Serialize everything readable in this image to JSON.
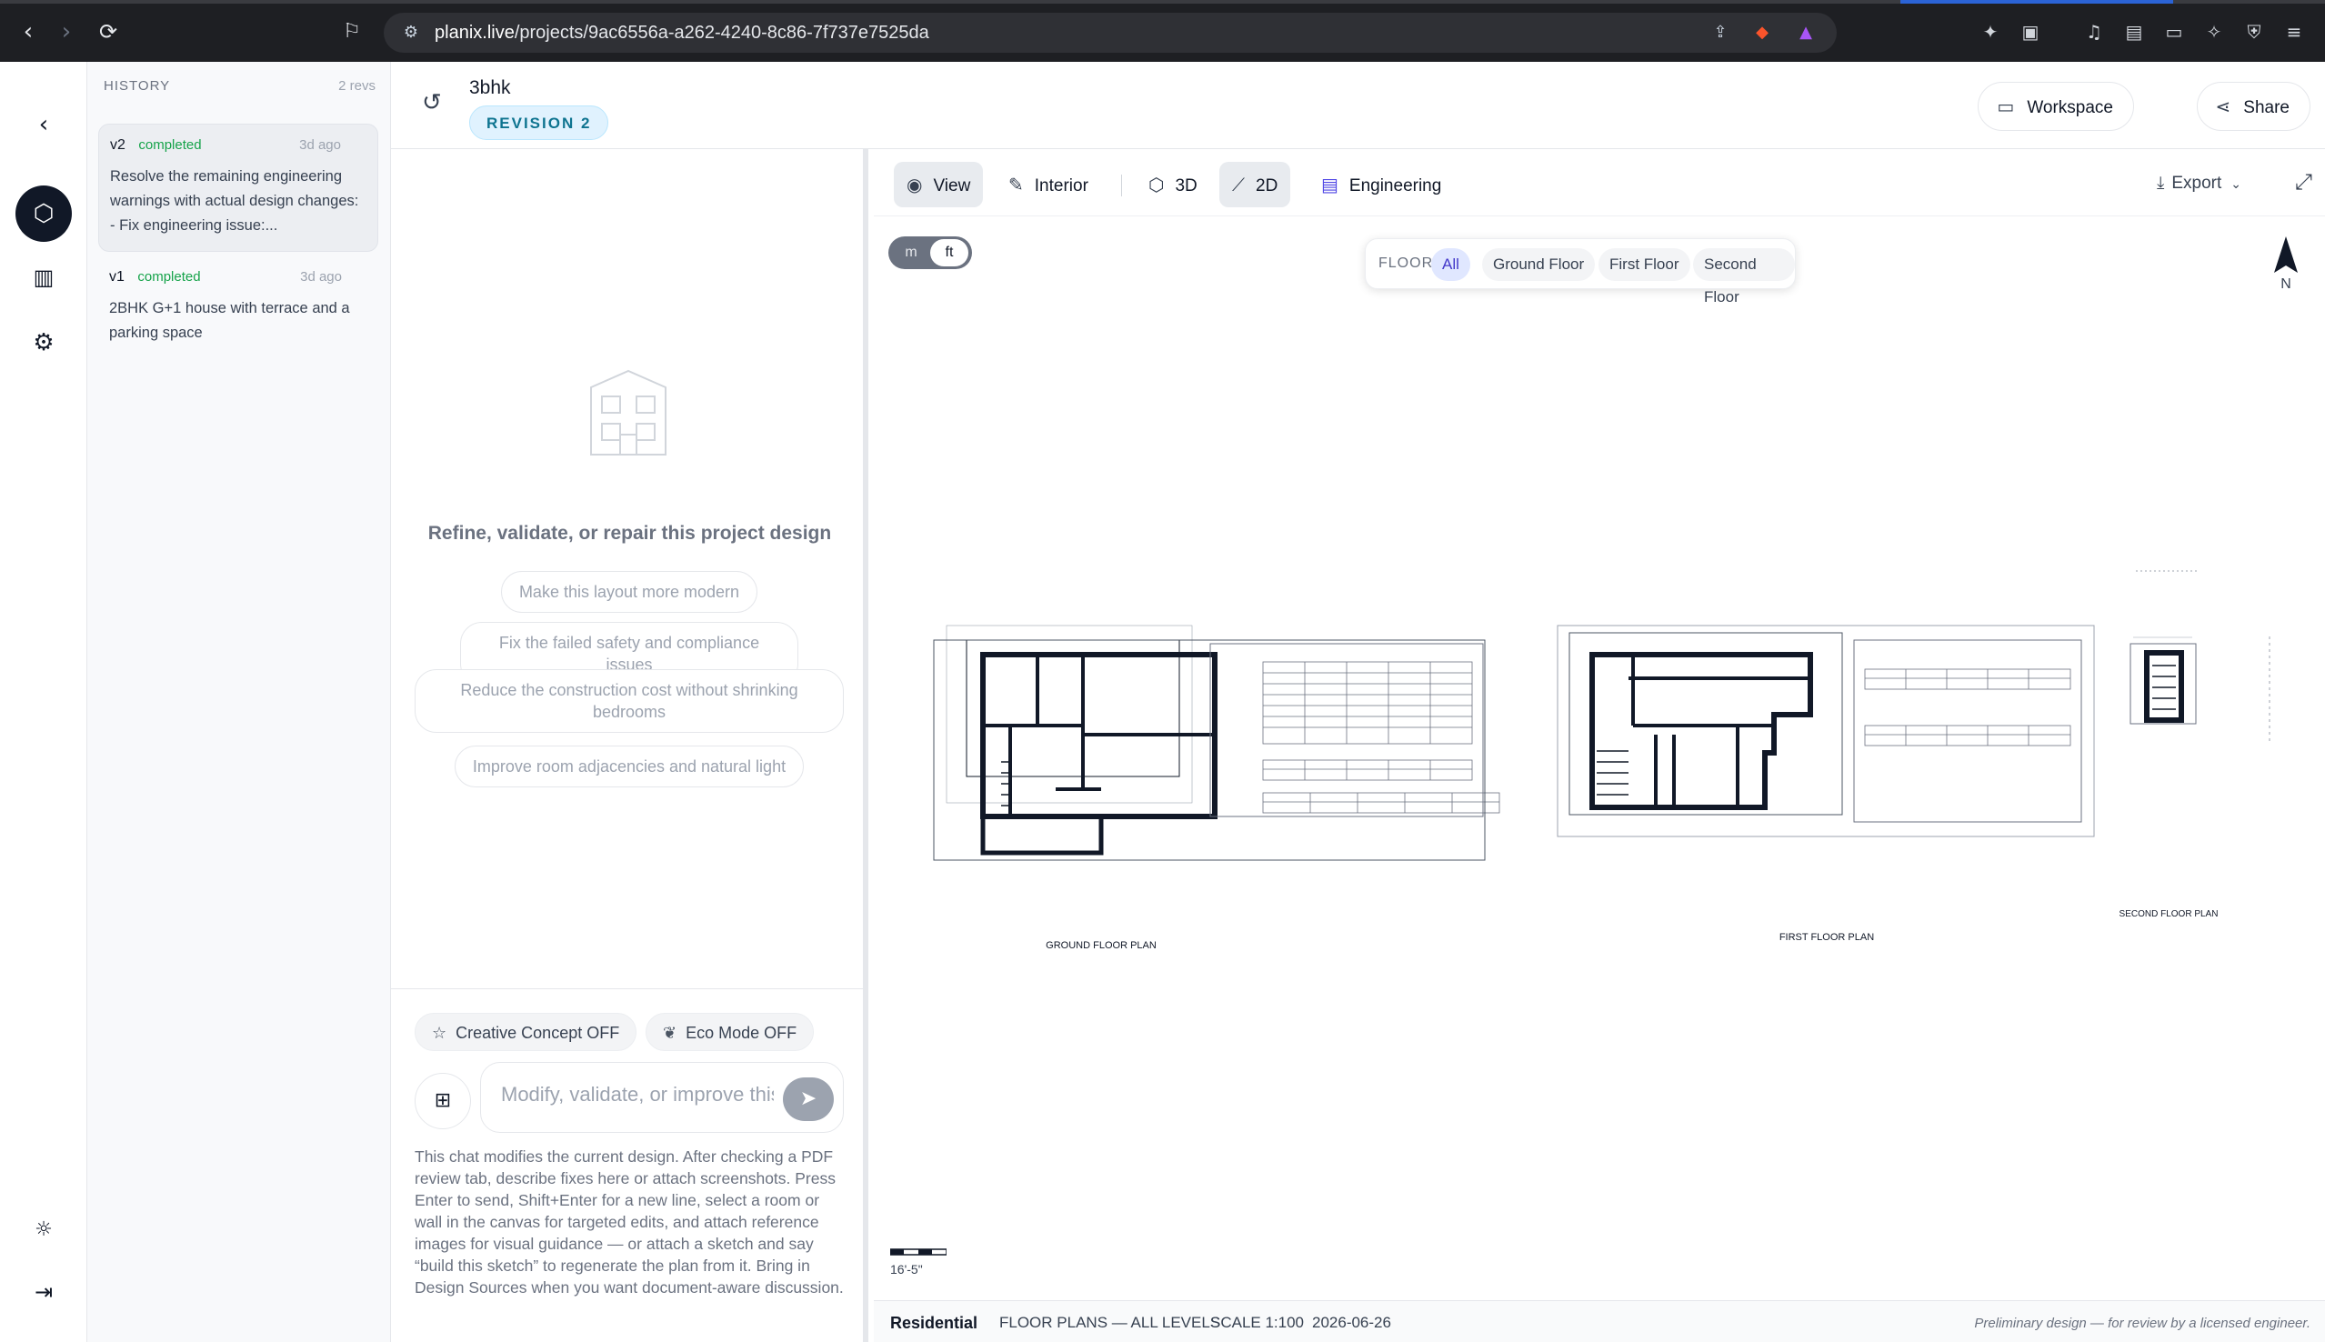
{
  "browser": {
    "url_host": "planix.live",
    "url_path": "/projects/9ac6556a-a262-4240-8c86-7f737e7525da"
  },
  "rail": {
    "icons": [
      "back-arrow-icon",
      "cube-icon",
      "report-icon",
      "gear-icon",
      "sun-icon",
      "logout-icon"
    ]
  },
  "history": {
    "title": "HISTORY",
    "count": "2 revs",
    "revisions": [
      {
        "version": "v2",
        "status": "completed",
        "time": "3d ago",
        "text": "Resolve the remaining engineering warnings with actual design changes: - Fix engineering issue:..."
      },
      {
        "version": "v1",
        "status": "completed",
        "time": "3d ago",
        "text": "2BHK G+1 house with terrace and a parking space"
      }
    ]
  },
  "header": {
    "project_name": "3bhk",
    "revision_badge": "REVISION 2",
    "workspace_label": "Workspace",
    "share_label": "Share"
  },
  "chat": {
    "empty_title": "Refine, validate, or repair this project design",
    "suggestions": [
      "Make this layout more modern",
      "Fix the failed safety and compliance issues",
      "Reduce the construction cost without shrinking bedrooms",
      "Improve room adjacencies and natural light"
    ],
    "creative_toggle": "Creative Concept OFF",
    "eco_toggle": "Eco Mode OFF",
    "input_placeholder": "Modify, validate, or improve this design...",
    "help_text": "This chat modifies the current design. After checking a PDF review tab, describe fixes here or attach screenshots. Press Enter to send, Shift+Enter for a new line, select a room or wall in the canvas for targeted edits, and attach reference images for visual guidance — or attach a sketch and say “build this sketch” to regenerate the plan from it. Bring in Design Sources when you want document-aware discussion."
  },
  "toolbar": {
    "view": "View",
    "interior": "Interior",
    "three_d": "3D",
    "two_d": "2D",
    "engineering": "Engineering",
    "export": "Export"
  },
  "units": {
    "metric": "m",
    "imperial": "ft",
    "selected": "ft"
  },
  "floors": {
    "label": "FLOOR",
    "options": [
      "All",
      "Ground Floor",
      "First Floor",
      "Second Floor"
    ],
    "selected": "All"
  },
  "compass": {
    "label": "N"
  },
  "drawing": {
    "plans": [
      {
        "title": "GROUND FLOOR PLAN"
      },
      {
        "title": "FIRST FLOOR PLAN"
      },
      {
        "title": "SECOND FLOOR PLAN"
      }
    ],
    "scale_label": "16'-5\""
  },
  "status": {
    "type": "Residential",
    "sheet": "FLOOR PLANS — ALL LEVELS",
    "scale": "SCALE 1:100",
    "date": "2026-06-26",
    "note": "Preliminary design — for review by a licensed engineer."
  },
  "colors": {
    "accent": "#111827",
    "badge_bg": "#e0f2fe",
    "badge_text": "#0e7490",
    "status_completed": "#16a34a",
    "floor_active": "#4338ca"
  }
}
